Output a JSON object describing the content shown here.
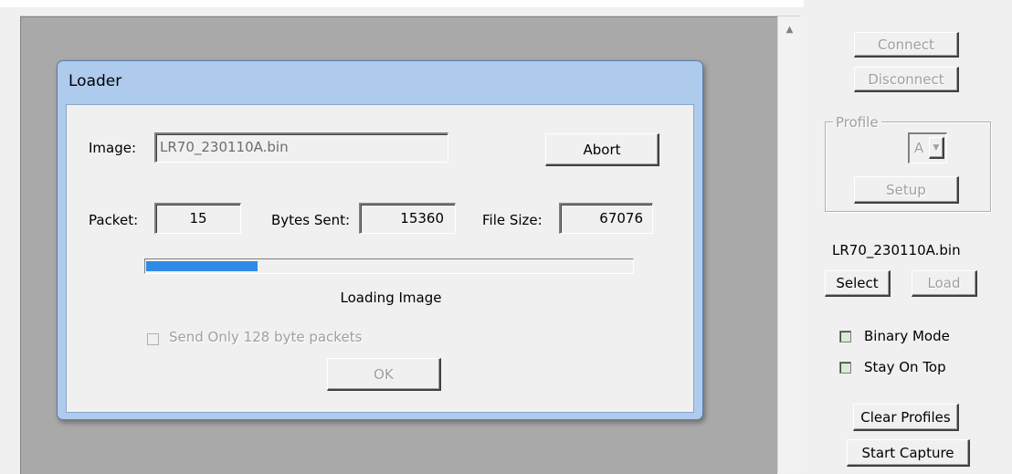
{
  "loader": {
    "title": "Loader",
    "image_label": "Image:",
    "image_value": "LR70_230110A.bin",
    "abort_label": "Abort",
    "packet_label": "Packet:",
    "packet_value": "15",
    "bytes_sent_label": "Bytes Sent:",
    "bytes_sent_value": "15360",
    "file_size_label": "File Size:",
    "file_size_value": "67076",
    "progress_fraction": 0.229,
    "status_text": "Loading Image",
    "send_only_label": "Send Only 128 byte packets",
    "ok_label": "OK",
    "progress_color": "#2e8ae6"
  },
  "panel": {
    "connect_label": "Connect",
    "disconnect_label": "Disconnect",
    "profile_label": "Profile",
    "profile_value": "A",
    "setup_label": "Setup",
    "file_name": "LR70_230110A.bin",
    "select_label": "Select",
    "load_label": "Load",
    "binary_mode_label": "Binary Mode",
    "stay_on_top_label": "Stay On Top",
    "checkbox_fill": "#d6ecd3",
    "clear_profiles_label": "Clear Profiles",
    "start_capture_label": "Start Capture"
  },
  "icons": {
    "scroll_up": "▲",
    "combo_arrow": "▼"
  }
}
